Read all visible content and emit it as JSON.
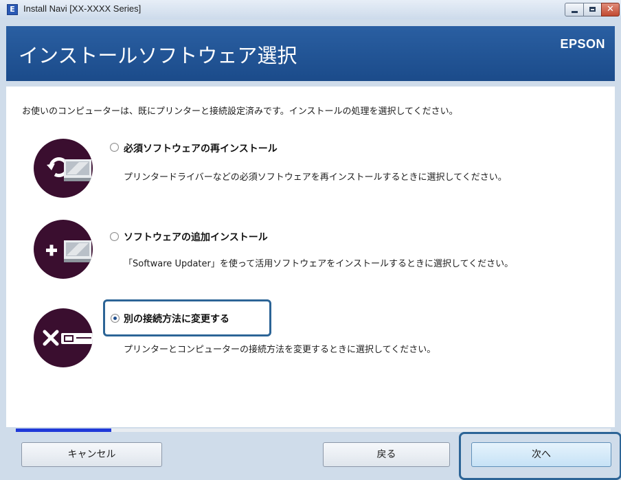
{
  "window": {
    "title": "Install Navi [XX-XXXX Series]",
    "app_icon_glyph": "E",
    "min_icon": "minimize-icon",
    "max_icon": "maximize-icon",
    "close_icon": "close-icon",
    "close_glyph": "✕"
  },
  "header": {
    "title": "インストールソフトウェア選択",
    "brand": "EPSON"
  },
  "content": {
    "instruction": "お使いのコンピューターは、既にプリンターと接続設定済みです。インストールの処理を選択してください。",
    "options": [
      {
        "label": "必須ソフトウェアの再インストール",
        "description": "プリンタードライバーなどの必須ソフトウェアを再インストールするときに選択してください。",
        "selected": false,
        "icon": "reinstall-icon"
      },
      {
        "label": "ソフトウェアの追加インストール",
        "description": "「Software Updater」を使って活用ソフトウェアをインストールするときに選択してください。",
        "selected": false,
        "icon": "add-install-icon"
      },
      {
        "label": "別の接続方法に変更する",
        "description": "プリンターとコンピューターの接続方法を変更するときに選択してください。",
        "selected": true,
        "icon": "change-connection-icon"
      }
    ],
    "progress_fraction": 0.16
  },
  "footer": {
    "cancel_label": "キャンセル",
    "back_label": "戻る",
    "next_label": "次へ"
  },
  "colors": {
    "header_bg": "#1b4b8a",
    "icon_bg": "#3a0e2f",
    "progress": "#1f39d8",
    "focus": "#2c6496"
  }
}
